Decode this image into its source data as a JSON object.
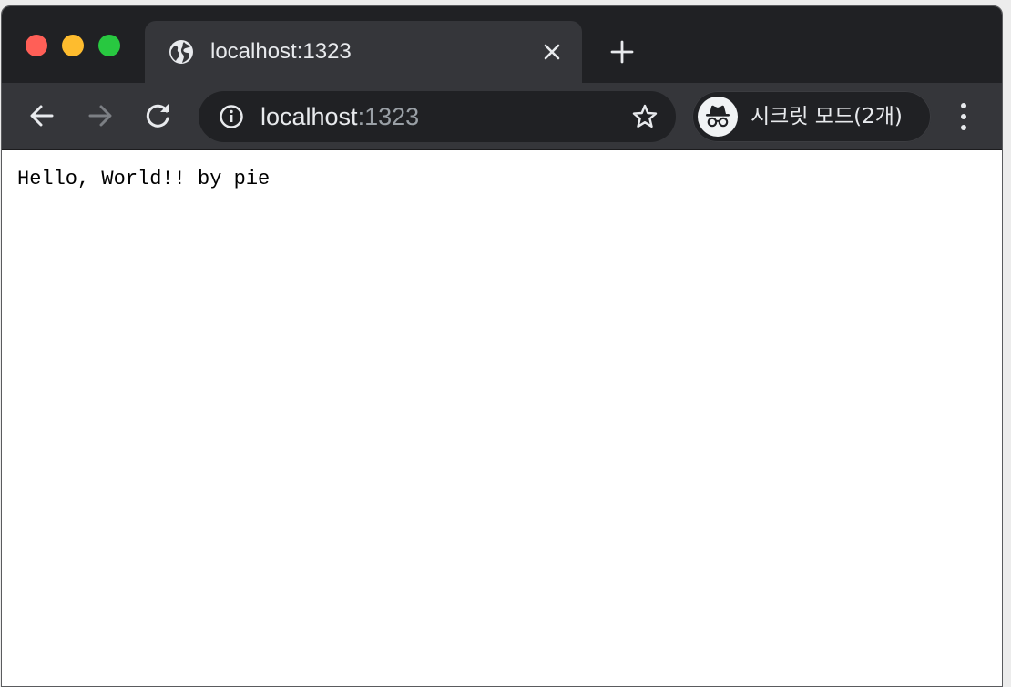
{
  "browser": {
    "tab": {
      "title": "localhost:1323",
      "favicon": "globe-icon"
    },
    "address_bar": {
      "host": "localhost",
      "port": ":1323"
    },
    "incognito_label": "시크릿 모드(2개)",
    "icons": {
      "back": "back-arrow-icon",
      "forward": "forward-arrow-icon",
      "reload": "reload-icon",
      "info": "info-icon",
      "bookmark": "star-icon",
      "new_tab": "plus-icon",
      "close_tab": "close-icon",
      "menu": "kebab-menu-icon",
      "incognito": "incognito-icon"
    },
    "colors": {
      "frame": "#202124",
      "toolbar": "#35363a",
      "text": "#e8eaed",
      "muted_text": "#9aa0a6"
    }
  },
  "page": {
    "body_text": "Hello, World!! by pie",
    "background": "#ffffff"
  }
}
